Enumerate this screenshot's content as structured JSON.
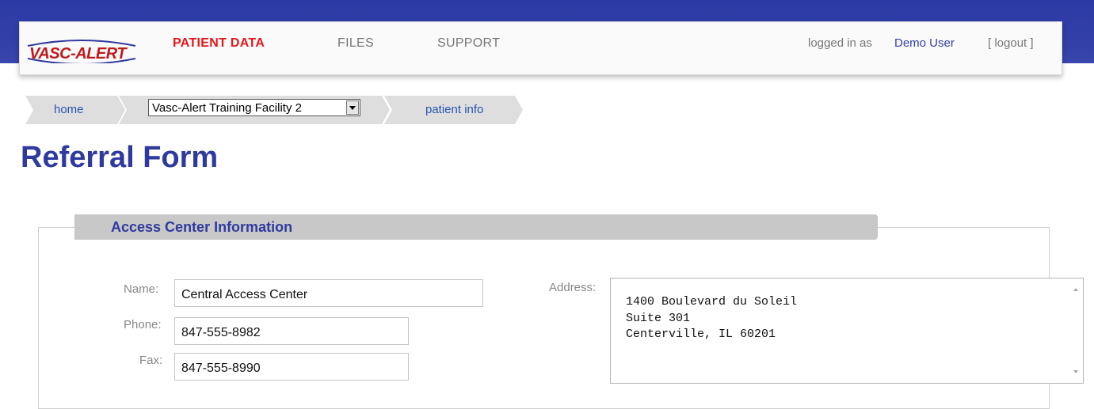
{
  "header": {
    "logo_text": "VASC-ALERT",
    "nav": [
      {
        "label": "PATIENT DATA",
        "active": true
      },
      {
        "label": "FILES",
        "active": false
      },
      {
        "label": "SUPPORT",
        "active": false
      }
    ],
    "logged_in_label": "logged in as",
    "user_name": "Demo User",
    "logout_label": "[ logout ]"
  },
  "breadcrumb": {
    "home": "home",
    "facility": "Vasc-Alert Training Facility 2",
    "patient_info": "patient info"
  },
  "page": {
    "title": "Referral Form"
  },
  "section": {
    "title": "Access Center Information",
    "fields": {
      "name_label": "Name:",
      "name_value": "Central Access Center",
      "phone_label": "Phone:",
      "phone_value": "847-555-8982",
      "fax_label": "Fax:",
      "fax_value": "847-555-8990",
      "address_label": "Address:",
      "address_lines": [
        "1400 Boulevard du Soleil",
        "Suite 301",
        "Centerville, IL 60201"
      ]
    }
  },
  "colors": {
    "brand_blue": "#2f3a9e",
    "nav_active_red": "#e3171b",
    "link_blue": "#2a55b0"
  }
}
